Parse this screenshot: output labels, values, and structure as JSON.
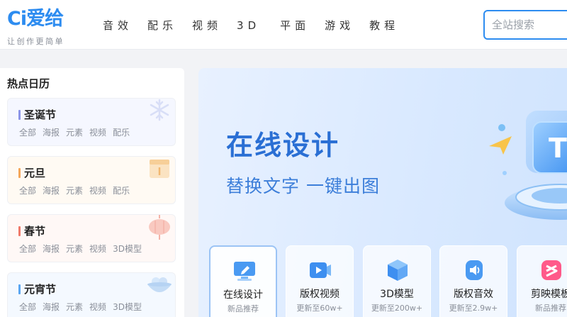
{
  "header": {
    "logo_mark": "Ci爱给",
    "slogan": "让创作更简单",
    "nav": [
      "音效",
      "配乐",
      "视频",
      "3D",
      "平面",
      "游戏",
      "教程"
    ],
    "search_placeholder": "全站搜索"
  },
  "sidebar": {
    "title": "热点日历",
    "items": [
      {
        "name": "圣诞节",
        "tags": [
          "全部",
          "海报",
          "元素",
          "视频",
          "配乐"
        ],
        "accent": "#8c95e8",
        "icon": "snowflake-icon"
      },
      {
        "name": "元旦",
        "tags": [
          "全部",
          "海报",
          "元素",
          "视频",
          "配乐"
        ],
        "accent": "#f5a75a",
        "icon": "calendar-icon"
      },
      {
        "name": "春节",
        "tags": [
          "全部",
          "海报",
          "元素",
          "视频",
          "3D模型"
        ],
        "accent": "#f07a6a",
        "icon": "lantern-icon"
      },
      {
        "name": "元宵节",
        "tags": [
          "全部",
          "海报",
          "元素",
          "视频",
          "3D模型"
        ],
        "accent": "#5ba7f2",
        "icon": "tangyuan-bowl-icon"
      }
    ]
  },
  "banner": {
    "title": "在线设计",
    "subtitle": "替换文字 一键出图",
    "tools": [
      {
        "name": "在线设计",
        "desc": "新品推荐",
        "icon": "monitor-pen-icon"
      },
      {
        "name": "版权视频",
        "desc": "更新至60w+",
        "icon": "video-play-icon"
      },
      {
        "name": "3D模型",
        "desc": "更新至200w+",
        "icon": "cube-icon"
      },
      {
        "name": "版权音效",
        "desc": "更新至2.9w+",
        "icon": "speaker-icon"
      },
      {
        "name": "剪映模板",
        "desc": "新品推荐",
        "icon": "capcut-icon"
      }
    ]
  },
  "colors": {
    "brand": "#2d8cf0",
    "banner_text": "#2a6fd4"
  }
}
